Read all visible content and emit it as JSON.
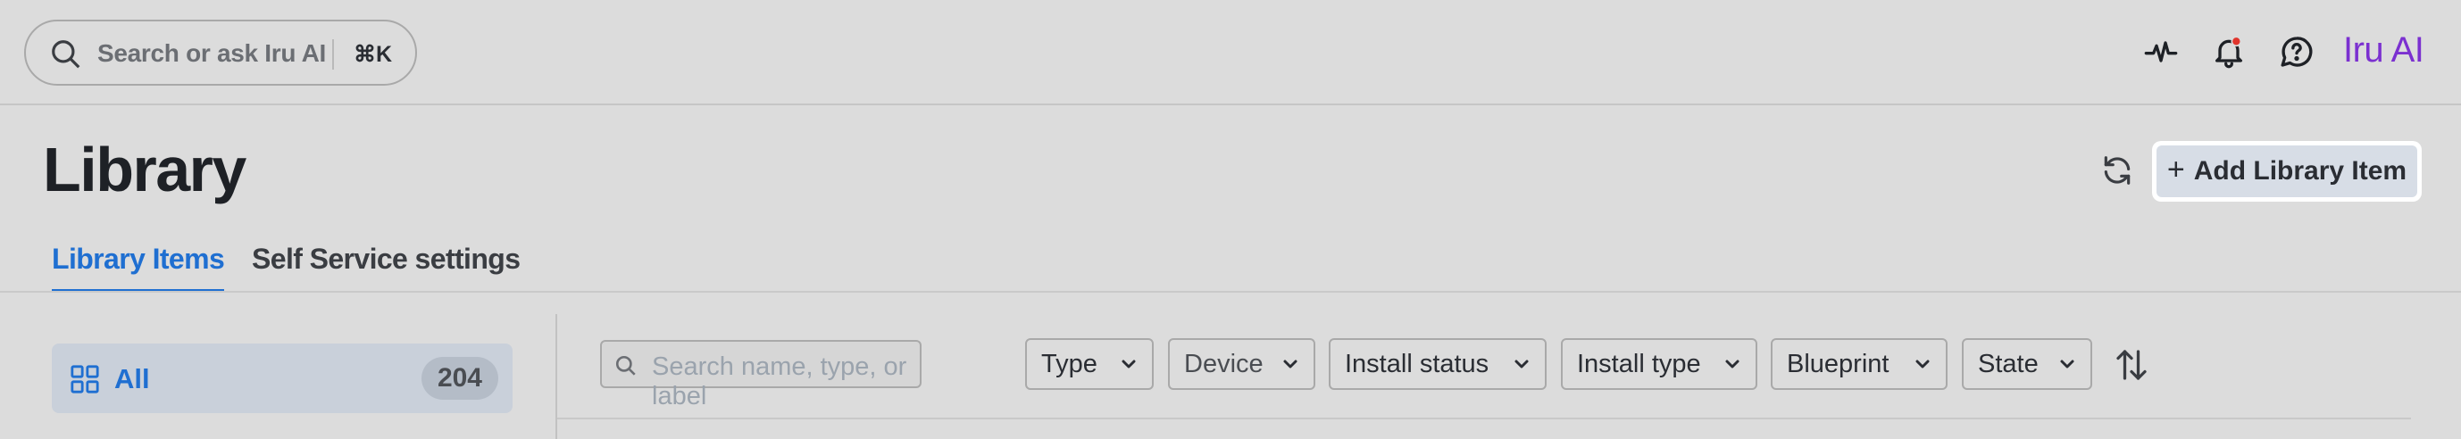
{
  "header": {
    "search_placeholder": "Search or ask Iru AI",
    "search_shortcut": "⌘K",
    "brand": "Iru AI",
    "brand_color": "#7b30d0",
    "icons": [
      "activity-icon",
      "bell-icon",
      "chat-help-icon"
    ],
    "notification_badge_color": "#e0342c"
  },
  "page": {
    "title": "Library",
    "add_button_label": "Add Library Item"
  },
  "tabs": [
    {
      "label": "Library Items",
      "active": true
    },
    {
      "label": "Self Service settings",
      "active": false
    }
  ],
  "sidebar": {
    "items": [
      {
        "label": "All",
        "count": "204",
        "selected": true
      }
    ]
  },
  "filters": {
    "search_placeholder": "Search name, type, or label",
    "dropdowns": [
      {
        "label": "Type"
      },
      {
        "label": "Device"
      },
      {
        "label": "Install status"
      },
      {
        "label": "Install type"
      },
      {
        "label": "Blueprint"
      },
      {
        "label": "State"
      }
    ]
  },
  "accent_color": "#1f6fd1"
}
